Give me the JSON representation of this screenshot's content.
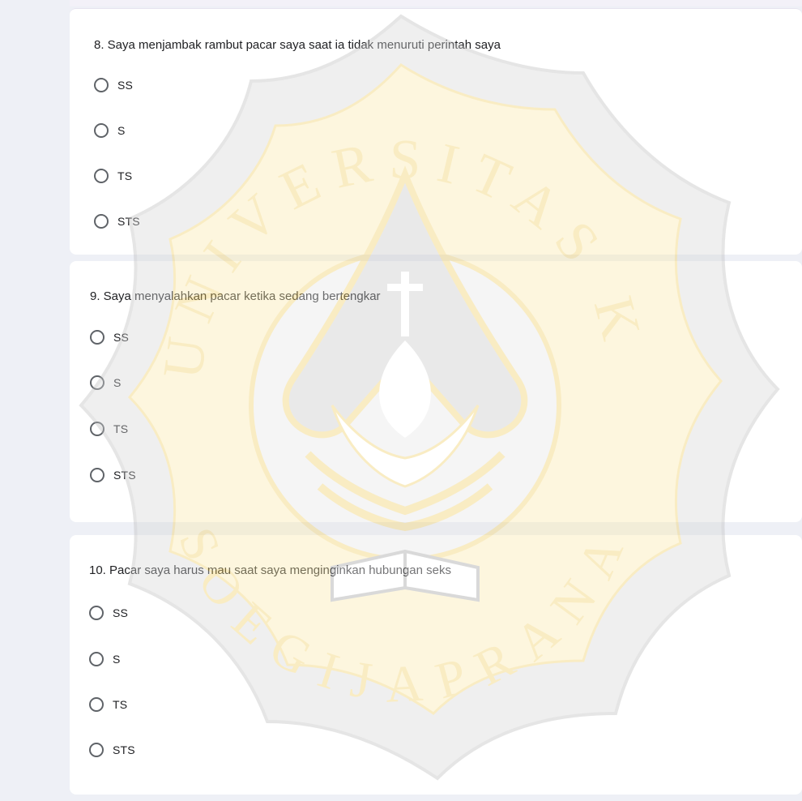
{
  "questions": [
    {
      "title": "8. Saya menjambak rambut pacar saya saat ia tidak menuruti perintah saya",
      "options": [
        "SS",
        "S",
        "TS",
        "STS"
      ]
    },
    {
      "title": "9. Saya menyalahkan pacar ketika sedang bertengkar",
      "options": [
        "SS",
        "S",
        "TS",
        "STS"
      ]
    },
    {
      "title": "10. Pacar saya harus mau saat saya menginginkan hubungan seks",
      "options": [
        "SS",
        "S",
        "TS",
        "STS"
      ]
    }
  ],
  "watermark": {
    "top_text": "UNIVERSITAS KATOLIK",
    "bottom_text": "SOEGIJAPRANATA",
    "gold": "#f5d36b",
    "gray": "#c9c9c9"
  }
}
